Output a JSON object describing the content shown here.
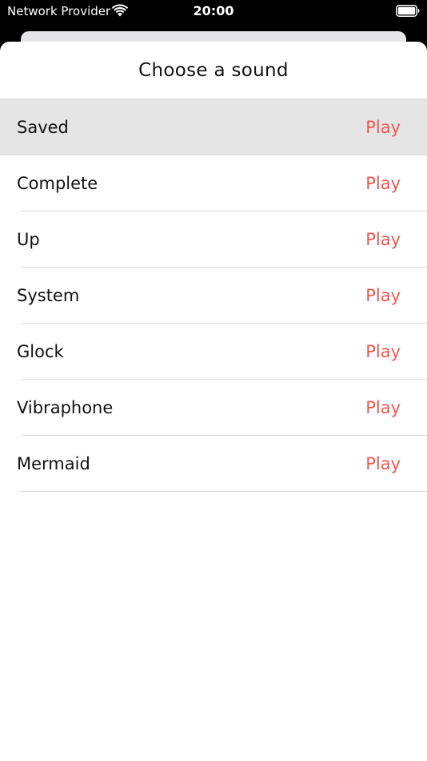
{
  "status_bar": {
    "carrier": "Network Provider",
    "time": "20:00",
    "wifi_icon": "wifi-icon",
    "battery_icon": "battery-icon"
  },
  "sheet": {
    "title": "Choose a sound",
    "accent_color": "#f0574e",
    "selected_background": "#e5e5e5"
  },
  "sounds": [
    {
      "name": "Saved",
      "action": "Play",
      "selected": true
    },
    {
      "name": "Complete",
      "action": "Play",
      "selected": false
    },
    {
      "name": "Up",
      "action": "Play",
      "selected": false
    },
    {
      "name": "System",
      "action": "Play",
      "selected": false
    },
    {
      "name": "Glock",
      "action": "Play",
      "selected": false
    },
    {
      "name": "Vibraphone",
      "action": "Play",
      "selected": false
    },
    {
      "name": "Mermaid",
      "action": "Play",
      "selected": false
    }
  ]
}
